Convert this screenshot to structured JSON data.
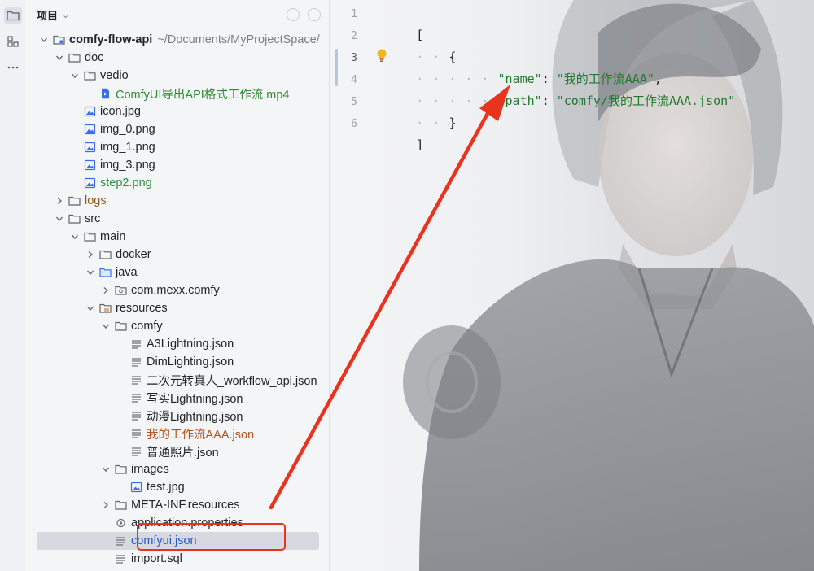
{
  "panel": {
    "title": "项目",
    "caret_icon": "chevron-down-icon"
  },
  "tree": [
    {
      "label": "comfy-flow-api",
      "hint": "~/Documents/MyProjectSpace/",
      "indent": 0,
      "chevron": "open",
      "icon": "module-folder-icon",
      "style": "bold"
    },
    {
      "label": "doc",
      "indent": 1,
      "chevron": "open",
      "icon": "folder-icon"
    },
    {
      "label": "vedio",
      "indent": 2,
      "chevron": "open",
      "icon": "folder-icon"
    },
    {
      "label": "ComfyUI导出API格式工作流.mp4",
      "indent": 3,
      "chevron": "none",
      "icon": "video-file-icon",
      "style": "green"
    },
    {
      "label": "icon.jpg",
      "indent": 2,
      "chevron": "none",
      "icon": "image-file-icon"
    },
    {
      "label": "img_0.png",
      "indent": 2,
      "chevron": "none",
      "icon": "image-file-icon"
    },
    {
      "label": "img_1.png",
      "indent": 2,
      "chevron": "none",
      "icon": "image-file-icon"
    },
    {
      "label": "img_3.png",
      "indent": 2,
      "chevron": "none",
      "icon": "image-file-icon"
    },
    {
      "label": "step2.png",
      "indent": 2,
      "chevron": "none",
      "icon": "image-file-icon",
      "style": "green"
    },
    {
      "label": "logs",
      "indent": 1,
      "chevron": "closed",
      "icon": "folder-icon",
      "style": "brown"
    },
    {
      "label": "src",
      "indent": 1,
      "chevron": "open",
      "icon": "folder-icon"
    },
    {
      "label": "main",
      "indent": 2,
      "chevron": "open",
      "icon": "folder-icon"
    },
    {
      "label": "docker",
      "indent": 3,
      "chevron": "closed",
      "icon": "folder-icon"
    },
    {
      "label": "java",
      "indent": 3,
      "chevron": "open",
      "icon": "source-folder-icon"
    },
    {
      "label": "com.mexx.comfy",
      "indent": 4,
      "chevron": "closed",
      "icon": "package-icon"
    },
    {
      "label": "resources",
      "indent": 3,
      "chevron": "open",
      "icon": "resources-folder-icon"
    },
    {
      "label": "comfy",
      "indent": 4,
      "chevron": "open",
      "icon": "folder-icon"
    },
    {
      "label": "A3Lightning.json",
      "indent": 5,
      "chevron": "none",
      "icon": "json-file-icon"
    },
    {
      "label": "DimLighting.json",
      "indent": 5,
      "chevron": "none",
      "icon": "json-file-icon"
    },
    {
      "label": "二次元转真人_workflow_api.json",
      "indent": 5,
      "chevron": "none",
      "icon": "json-file-icon"
    },
    {
      "label": "写实Lightning.json",
      "indent": 5,
      "chevron": "none",
      "icon": "json-file-icon"
    },
    {
      "label": "动漫Lightning.json",
      "indent": 5,
      "chevron": "none",
      "icon": "json-file-icon"
    },
    {
      "label": "我的工作流AAA.json",
      "indent": 5,
      "chevron": "none",
      "icon": "json-file-icon",
      "style": "orange"
    },
    {
      "label": "普通照片.json",
      "indent": 5,
      "chevron": "none",
      "icon": "json-file-icon"
    },
    {
      "label": "images",
      "indent": 4,
      "chevron": "open",
      "icon": "folder-icon"
    },
    {
      "label": "test.jpg",
      "indent": 5,
      "chevron": "none",
      "icon": "image-file-icon"
    },
    {
      "label": "META-INF.resources",
      "indent": 4,
      "chevron": "closed",
      "icon": "folder-icon"
    },
    {
      "label": "application.properties",
      "indent": 4,
      "chevron": "none",
      "icon": "settings-file-icon"
    },
    {
      "label": "comfyui.json",
      "indent": 4,
      "chevron": "none",
      "icon": "json-file-icon",
      "style": "blue",
      "selected": true
    },
    {
      "label": "import.sql",
      "indent": 4,
      "chevron": "none",
      "icon": "json-file-icon"
    }
  ],
  "editor": {
    "line_numbers": [
      "1",
      "2",
      "3",
      "4",
      "5",
      "6"
    ],
    "current_line": "3",
    "lines": [
      {
        "dots": "",
        "text": "["
      },
      {
        "dots": "· · ",
        "text": "{"
      },
      {
        "dots": "· · · · · ",
        "key": "\"name\"",
        "sep": ": ",
        "value": "\"我的工作流AAA\"",
        "end": ","
      },
      {
        "dots": "· · · · · ",
        "key": "\"path\"",
        "sep": ": ",
        "value": "\"comfy/我的工作流AAA.json\"",
        "end": ""
      },
      {
        "dots": "· · ",
        "text": "}"
      },
      {
        "dots": "",
        "text": "]"
      }
    ],
    "gutter_icon": "lightbulb-icon"
  },
  "colors": {
    "highlight_red": "#e8331f",
    "json_string": "#1d7a2e",
    "vcs_added": "#2f8a36",
    "vcs_modified": "#b3551f"
  }
}
